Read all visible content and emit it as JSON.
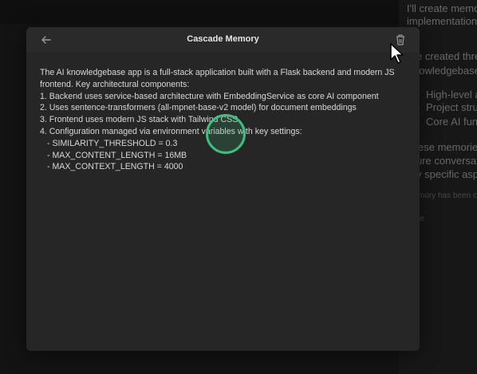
{
  "background_panel": {
    "lines": [
      "I'll create memor",
      "implementation d",
      "e created thre",
      "nowledgebase a",
      "High-level a",
      "Project struc",
      "Core AI func",
      "ese memories",
      "ure conversat",
      "y specific aspe",
      "mory has been c",
      "e"
    ]
  },
  "modal": {
    "title": "Cascade Memory",
    "back_icon": "arrow-left-icon",
    "delete_icon": "trash-icon",
    "body": {
      "intro": "The AI knowledgebase app is a full-stack application built with a Flask backend and modern JS frontend. Key architectural components:",
      "items": [
        "1. Backend uses service-based architecture with EmbeddingService as core AI component",
        "2. Uses sentence-transformers (all-mpnet-base-v2 model) for document embeddings",
        "3. Frontend uses modern JS stack with Tailwind CSS",
        "4. Configuration managed via environment variables with key settings:"
      ],
      "settings": [
        "- SIMILARITY_THRESHOLD = 0.3",
        "- MAX_CONTENT_LENGTH = 16MB",
        "- MAX_CONTEXT_LENGTH = 4000"
      ]
    }
  },
  "colors": {
    "click_ring": "#3fbf7f",
    "modal_bg": "#262626"
  }
}
